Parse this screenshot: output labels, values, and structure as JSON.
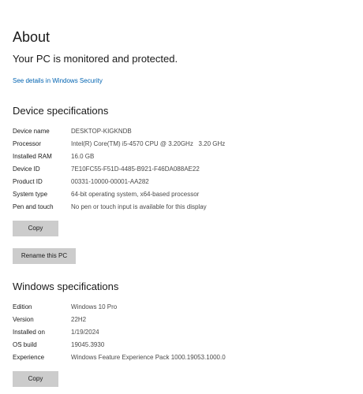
{
  "header": {
    "title": "About",
    "protection_status": "Your PC is monitored and protected.",
    "security_link": "See details in Windows Security"
  },
  "device_specs": {
    "title": "Device specifications",
    "rows": [
      {
        "label": "Device name",
        "value": "DESKTOP-KIGKNDB"
      },
      {
        "label": "Processor",
        "value": "Intel(R) Core(TM) i5-4570 CPU @ 3.20GHz   3.20 GHz"
      },
      {
        "label": "Installed RAM",
        "value": "16.0 GB"
      },
      {
        "label": "Device ID",
        "value": "7E10FC55-F51D-4485-B921-F46DA088AE22"
      },
      {
        "label": "Product ID",
        "value": "00331-10000-00001-AA282"
      },
      {
        "label": "System type",
        "value": "64-bit operating system, x64-based processor"
      },
      {
        "label": "Pen and touch",
        "value": "No pen or touch input is available for this display"
      }
    ],
    "copy_label": "Copy",
    "rename_label": "Rename this PC"
  },
  "windows_specs": {
    "title": "Windows specifications",
    "rows": [
      {
        "label": "Edition",
        "value": "Windows 10 Pro"
      },
      {
        "label": "Version",
        "value": "22H2"
      },
      {
        "label": "Installed on",
        "value": "1/19/2024"
      },
      {
        "label": "OS build",
        "value": "19045.3930"
      },
      {
        "label": "Experience",
        "value": "Windows Feature Experience Pack 1000.19053.1000.0"
      }
    ],
    "copy_label": "Copy"
  }
}
